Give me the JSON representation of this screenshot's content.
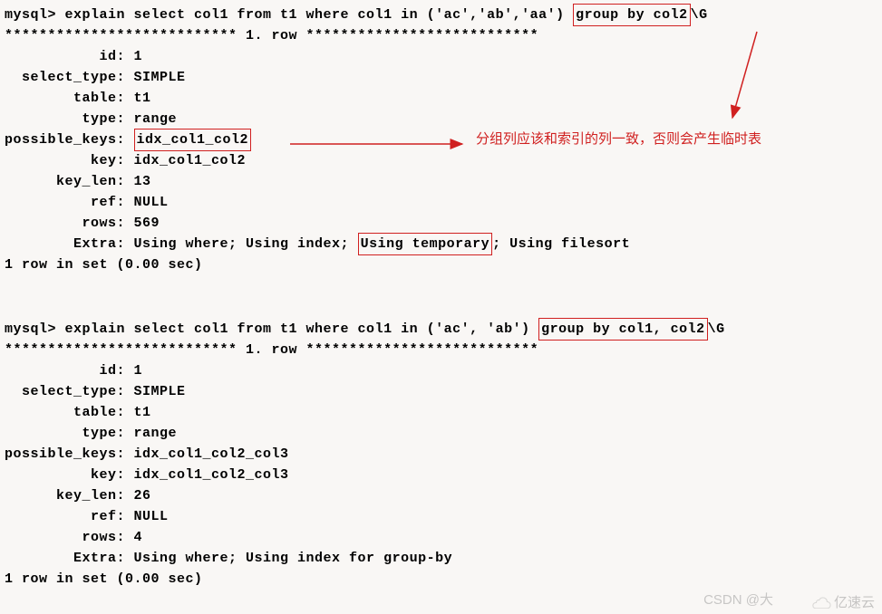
{
  "q1": {
    "prompt": "mysql> explain select col1 from t1 where col1 in ('ac','ab','aa') ",
    "group_by": "group by col2",
    "tail": "\\G",
    "row_header": "*************************** 1. row ***************************",
    "fields": {
      "id": "           id: 1",
      "select_type": "  select_type: SIMPLE",
      "table": "        table: t1",
      "type": "         type: range",
      "pk_label": "possible_keys: ",
      "pk_value": "idx_col1_col2",
      "key": "          key: idx_col1_col2",
      "key_len": "      key_len: 13",
      "ref": "          ref: NULL",
      "rows": "         rows: 569",
      "extra_pre": "        Extra: Using where; Using index; ",
      "extra_box": "Using temporary",
      "extra_post": "; Using filesort"
    },
    "footer": "1 row in set (0.00 sec)"
  },
  "annotation": "分组列应该和索引的列一致，否则会产生临时表",
  "q2": {
    "prompt": "mysql> explain select col1 from t1 where col1 in ('ac', 'ab') ",
    "group_by": "group by col1, col2",
    "tail": "\\G",
    "row_header": "*************************** 1. row ***************************",
    "fields": {
      "id": "           id: 1",
      "select_type": "  select_type: SIMPLE",
      "table": "        table: t1",
      "type": "         type: range",
      "possible_keys": "possible_keys: idx_col1_col2_col3",
      "key": "          key: idx_col1_col2_col3",
      "key_len": "      key_len: 26",
      "ref": "          ref: NULL",
      "rows": "         rows: 4",
      "extra": "        Extra: Using where; Using index for group-by"
    },
    "footer": "1 row in set (0.00 sec)"
  },
  "watermarks": {
    "csdn": "CSDN @大",
    "yisu": "亿速云"
  }
}
